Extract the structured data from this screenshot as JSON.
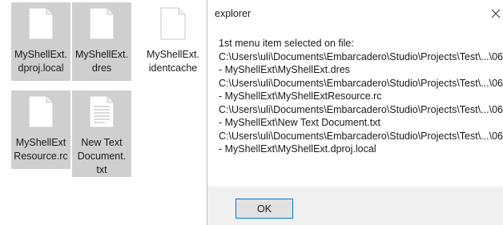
{
  "files": [
    {
      "name": "MyShellExt.\ndproj.local",
      "icon": "blank-file-icon",
      "selected": true
    },
    {
      "name": "MyShellExt.\ndres",
      "icon": "blank-file-icon",
      "selected": true
    },
    {
      "name": "MyShellExt.\nidentcache",
      "icon": "blank-file-icon",
      "selected": false
    },
    {
      "name": "MyShellExt\nResource.rc",
      "icon": "blank-file-icon",
      "selected": true
    },
    {
      "name": "New Text\nDocument.\ntxt",
      "icon": "text-file-icon",
      "selected": true
    }
  ],
  "dialog": {
    "title": "explorer",
    "close_icon": "close-icon",
    "lines": [
      "1st menu item selected on file:",
      "C:\\Users\\uli\\Documents\\Embarcadero\\Studio\\Projects\\Test\\...\\06",
      "- MyShellExt\\MyShellExt.dres",
      "C:\\Users\\uli\\Documents\\Embarcadero\\Studio\\Projects\\Test\\...\\06",
      "- MyShellExt\\MyShellExtResource.rc",
      "C:\\Users\\uli\\Documents\\Embarcadero\\Studio\\Projects\\Test\\...\\06",
      "- MyShellExt\\New Text Document.txt",
      "C:\\Users\\uli\\Documents\\Embarcadero\\Studio\\Projects\\Test\\...\\06",
      "- MyShellExt\\MyShellExt.dproj.local"
    ],
    "ok_label": "OK"
  }
}
